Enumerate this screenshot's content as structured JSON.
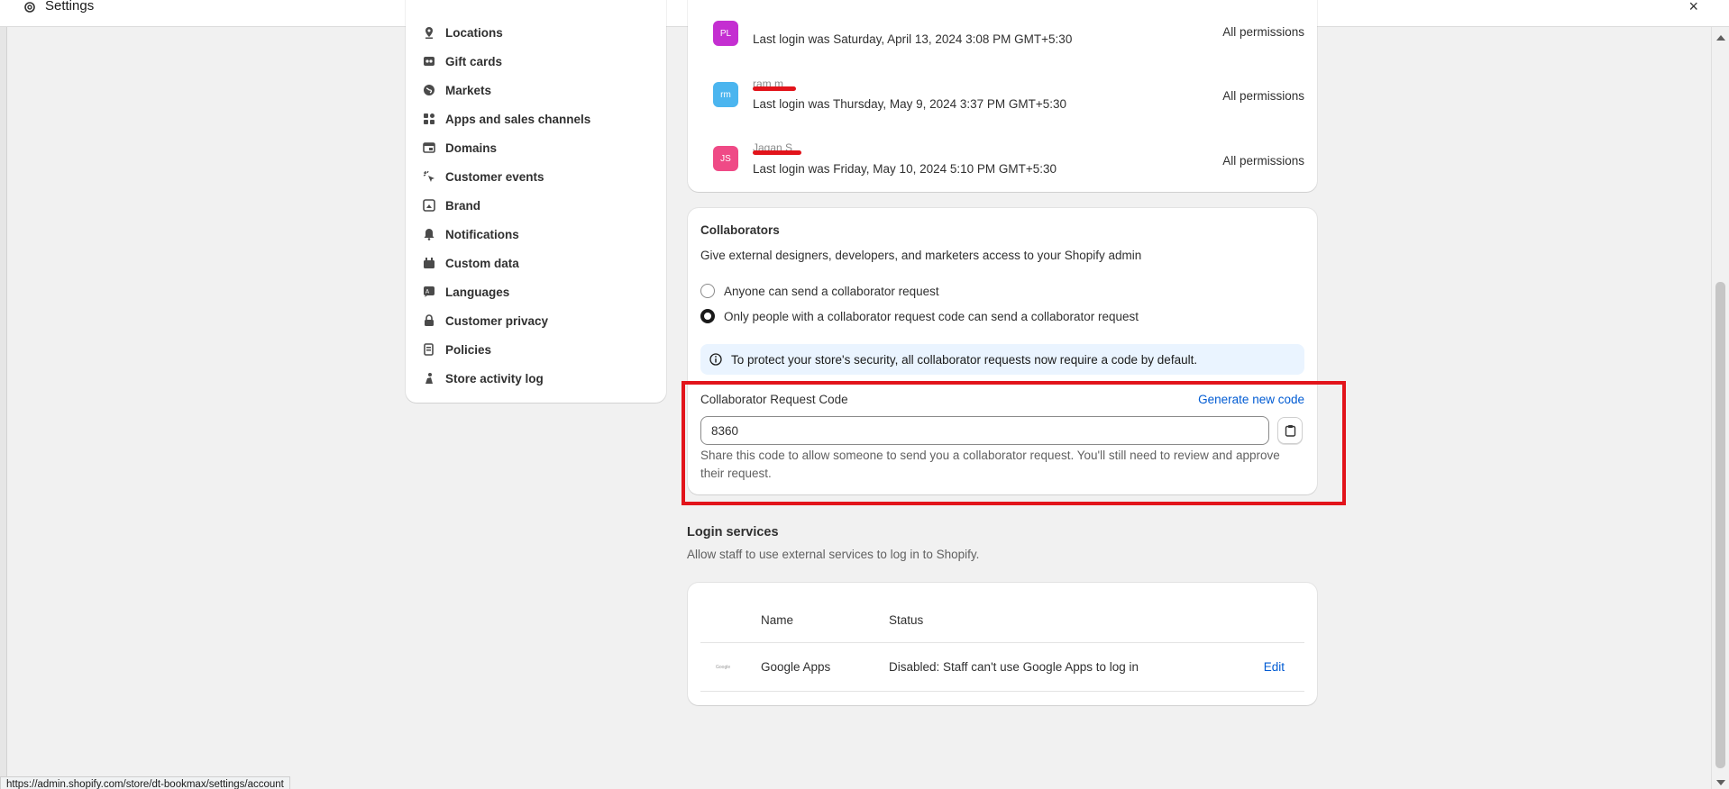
{
  "window": {
    "title": "Settings",
    "close_glyph": "×"
  },
  "sidebar": {
    "items": [
      {
        "label": "Locations",
        "icon": "location-pin-icon"
      },
      {
        "label": "Gift cards",
        "icon": "gift-card-icon"
      },
      {
        "label": "Markets",
        "icon": "globe-icon"
      },
      {
        "label": "Apps and sales channels",
        "icon": "apps-icon"
      },
      {
        "label": "Domains",
        "icon": "domain-icon"
      },
      {
        "label": "Customer events",
        "icon": "cursor-click-icon"
      },
      {
        "label": "Brand",
        "icon": "brand-icon"
      },
      {
        "label": "Notifications",
        "icon": "bell-icon"
      },
      {
        "label": "Custom data",
        "icon": "custom-data-icon"
      },
      {
        "label": "Languages",
        "icon": "language-icon"
      },
      {
        "label": "Customer privacy",
        "icon": "lock-icon"
      },
      {
        "label": "Policies",
        "icon": "policies-icon"
      },
      {
        "label": "Store activity log",
        "icon": "activity-log-icon"
      }
    ]
  },
  "staff": {
    "rows": [
      {
        "initials": "PL",
        "color": "#c42fd1",
        "name": "",
        "last_login": "Last login was Saturday, April 13, 2024 3:08 PM GMT+5:30",
        "permissions": "All permissions"
      },
      {
        "initials": "rm",
        "color": "#4bb5ef",
        "name": "ram m",
        "last_login": "Last login was Thursday, May 9, 2024 3:37 PM GMT+5:30",
        "permissions": "All permissions"
      },
      {
        "initials": "JS",
        "color": "#ef4a86",
        "name": "Jagan S",
        "last_login": "Last login was Friday, May 10, 2024 5:10 PM GMT+5:30",
        "permissions": "All permissions"
      }
    ]
  },
  "collaborators": {
    "title": "Collaborators",
    "description": "Give external designers, developers, and marketers access to your Shopify admin",
    "options": [
      {
        "label": "Anyone can send a collaborator request",
        "selected": false
      },
      {
        "label": "Only people with a collaborator request code can send a collaborator request",
        "selected": true
      }
    ],
    "banner": "To protect your store's security, all collaborator requests now require a code by default.",
    "code_label": "Collaborator Request Code",
    "generate_label": "Generate new code",
    "code_value": "8360",
    "help": "Share this code to allow someone to send you a collaborator request. You'll still need to review and approve their request."
  },
  "login_services": {
    "title": "Login services",
    "subtitle": "Allow staff to use external services to log in to Shopify.",
    "headers": {
      "name": "Name",
      "status": "Status"
    },
    "row": {
      "logo_text": "Google",
      "name": "Google Apps",
      "status": "Disabled: Staff can't use Google Apps to log in",
      "action": "Edit"
    }
  },
  "status_url": "https://admin.shopify.com/store/dt-bookmax/settings/account",
  "colors": {
    "link": "#005bd3",
    "highlight": "#e2141b",
    "banner_bg": "#eaf4ff"
  }
}
